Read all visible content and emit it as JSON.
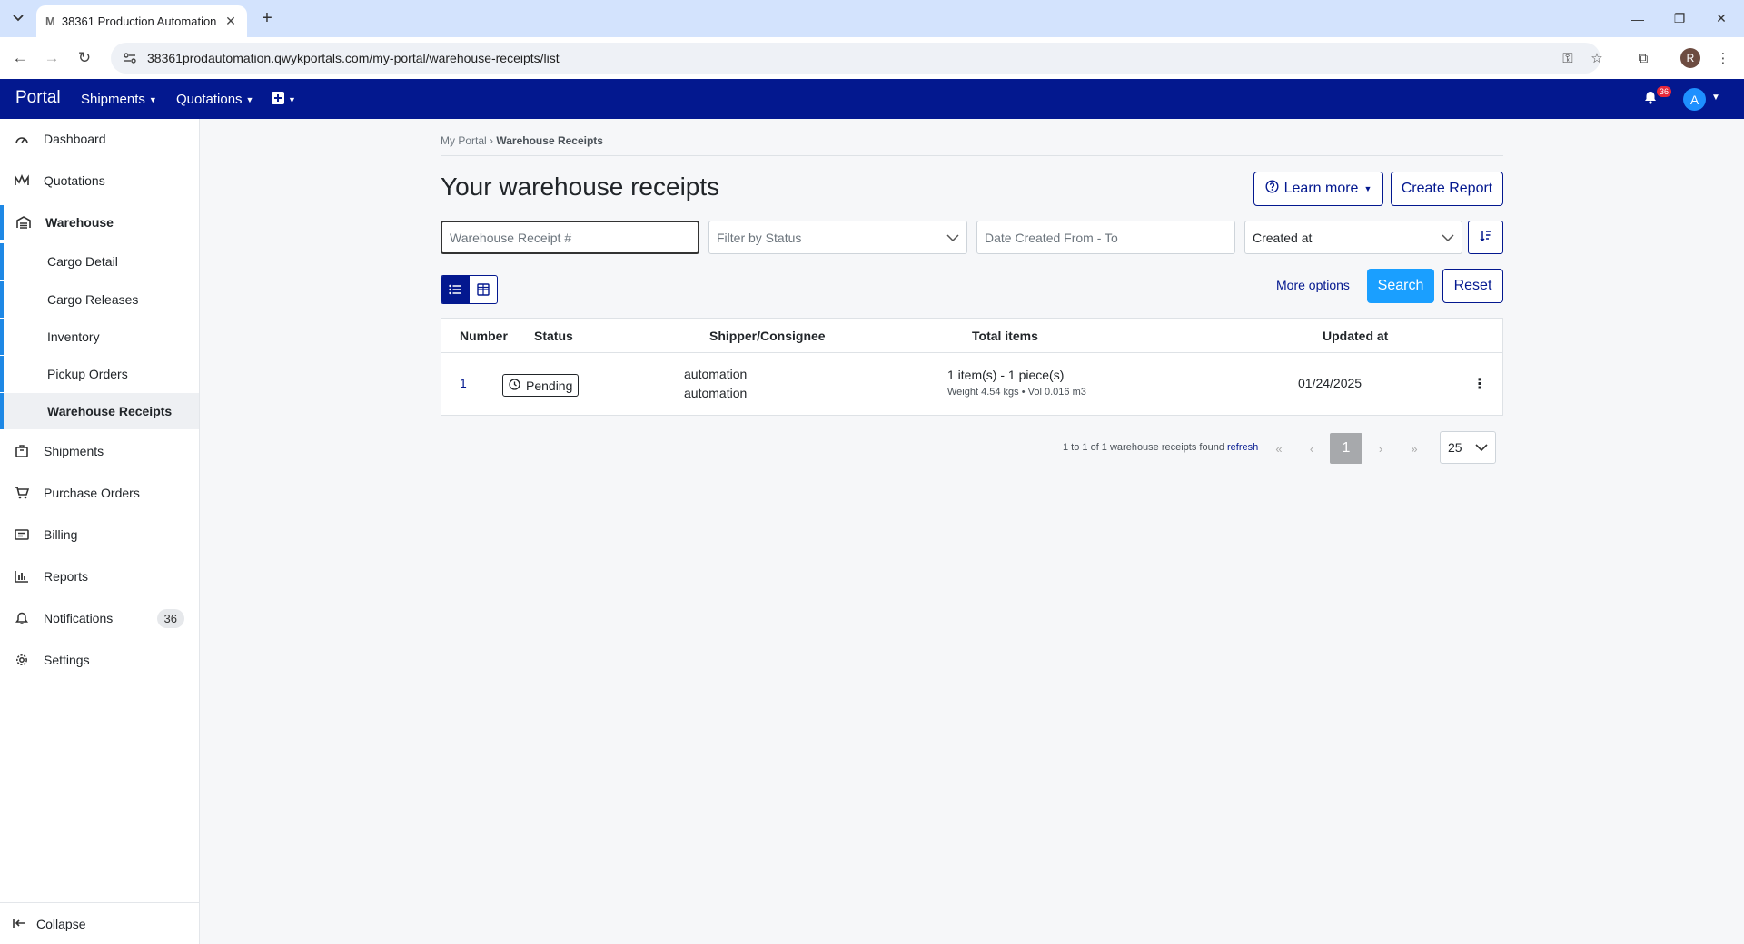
{
  "browser": {
    "tab_title": "38361 Production Automation",
    "tab_favicon": "M",
    "url": "38361prodautomation.qwykportals.com/my-portal/warehouse-receipts/list",
    "profile_initial": "R"
  },
  "topnav": {
    "brand": "Portal",
    "menus": [
      "Shipments",
      "Quotations"
    ],
    "notification_count": "36",
    "avatar_initial": "A",
    "bg_color": "#03188f"
  },
  "sidebar": {
    "items": [
      {
        "label": "Dashboard",
        "icon": "dashboard-icon"
      },
      {
        "label": "Quotations",
        "icon": "quotations-icon"
      },
      {
        "label": "Warehouse",
        "icon": "warehouse-icon"
      },
      {
        "label": "Shipments",
        "icon": "shipments-icon"
      },
      {
        "label": "Purchase Orders",
        "icon": "cart-icon"
      },
      {
        "label": "Billing",
        "icon": "billing-icon"
      },
      {
        "label": "Reports",
        "icon": "reports-icon"
      },
      {
        "label": "Notifications",
        "icon": "bell-icon",
        "count": "36"
      },
      {
        "label": "Settings",
        "icon": "gear-icon"
      }
    ],
    "warehouse_sub": [
      "Cargo Detail",
      "Cargo Releases",
      "Inventory",
      "Pickup Orders",
      "Warehouse Receipts"
    ],
    "collapse_label": "Collapse"
  },
  "main": {
    "breadcrumb_root": "My Portal",
    "breadcrumb_sep": "›",
    "breadcrumb_current": "Warehouse Receipts",
    "title": "Your warehouse receipts",
    "learn_more": "Learn more",
    "create_report": "Create Report",
    "filters": {
      "receipt_placeholder": "Warehouse Receipt #",
      "status_placeholder": "Filter by Status",
      "date_placeholder": "Date Created From - To",
      "sort_value": "Created at"
    },
    "more_options": "More options",
    "search": "Search",
    "reset": "Reset"
  },
  "table": {
    "headers": [
      "Number",
      "Status",
      "Shipper/Consignee",
      "Total items",
      "Updated at"
    ],
    "rows": [
      {
        "number": "1",
        "status": "Pending",
        "shipper": "automation",
        "consignee": "automation",
        "items": "1 item(s) - 1 piece(s)",
        "weight_vol": "Weight 4.54 kgs • Vol 0.016 m3",
        "updated": "01/24/2025"
      }
    ]
  },
  "pagination": {
    "summary": "1 to 1 of 1 warehouse receipts found",
    "refresh": "refresh",
    "current_page": "1",
    "page_size": "25"
  }
}
